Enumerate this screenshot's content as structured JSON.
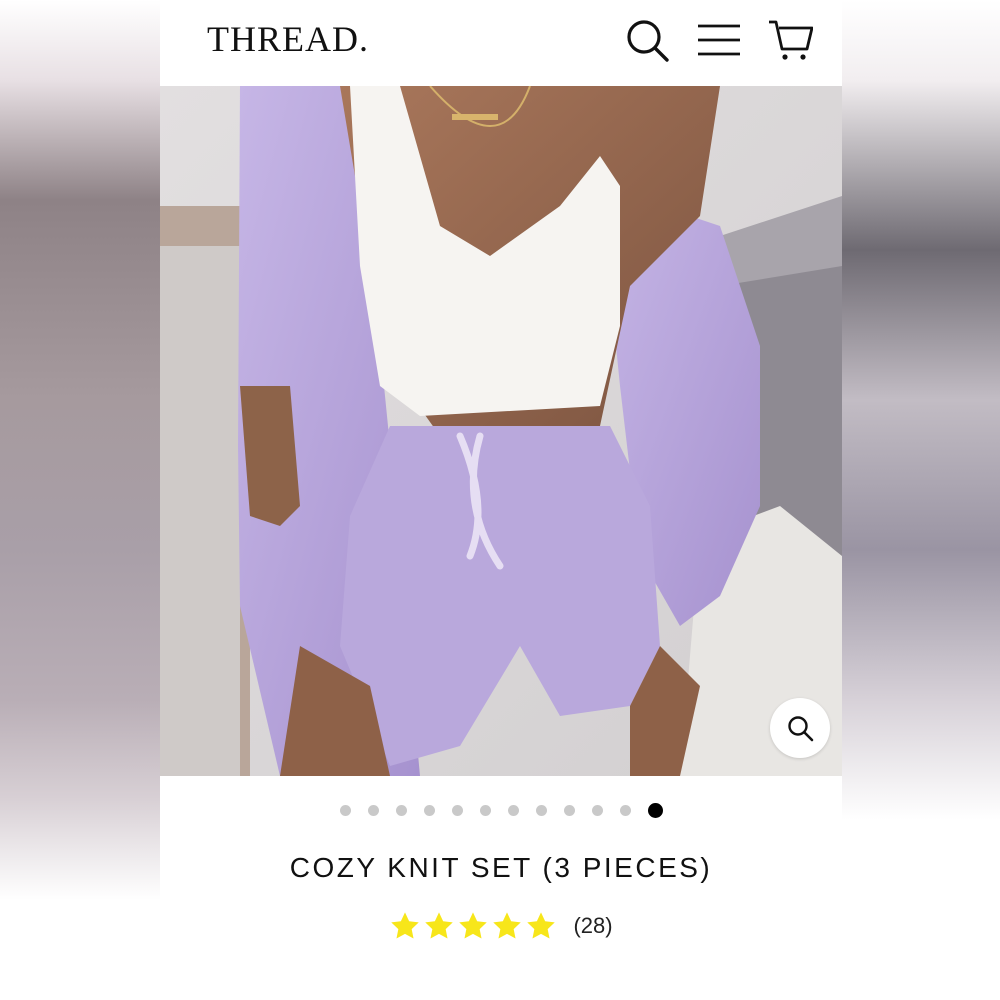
{
  "header": {
    "logo": "THREAD.",
    "icons": [
      "search-icon",
      "menu-icon",
      "cart-icon"
    ]
  },
  "gallery": {
    "total_images": 12,
    "active_index": 12
  },
  "product": {
    "title": "COZY KNIT SET (3 PIECES)",
    "rating": 5,
    "review_count": "(28)"
  },
  "colors": {
    "accent_star": "#f7e61a",
    "lavender": "#b9a8dc",
    "dot_active": "#000000",
    "dot_inactive": "#c9c9c9"
  }
}
